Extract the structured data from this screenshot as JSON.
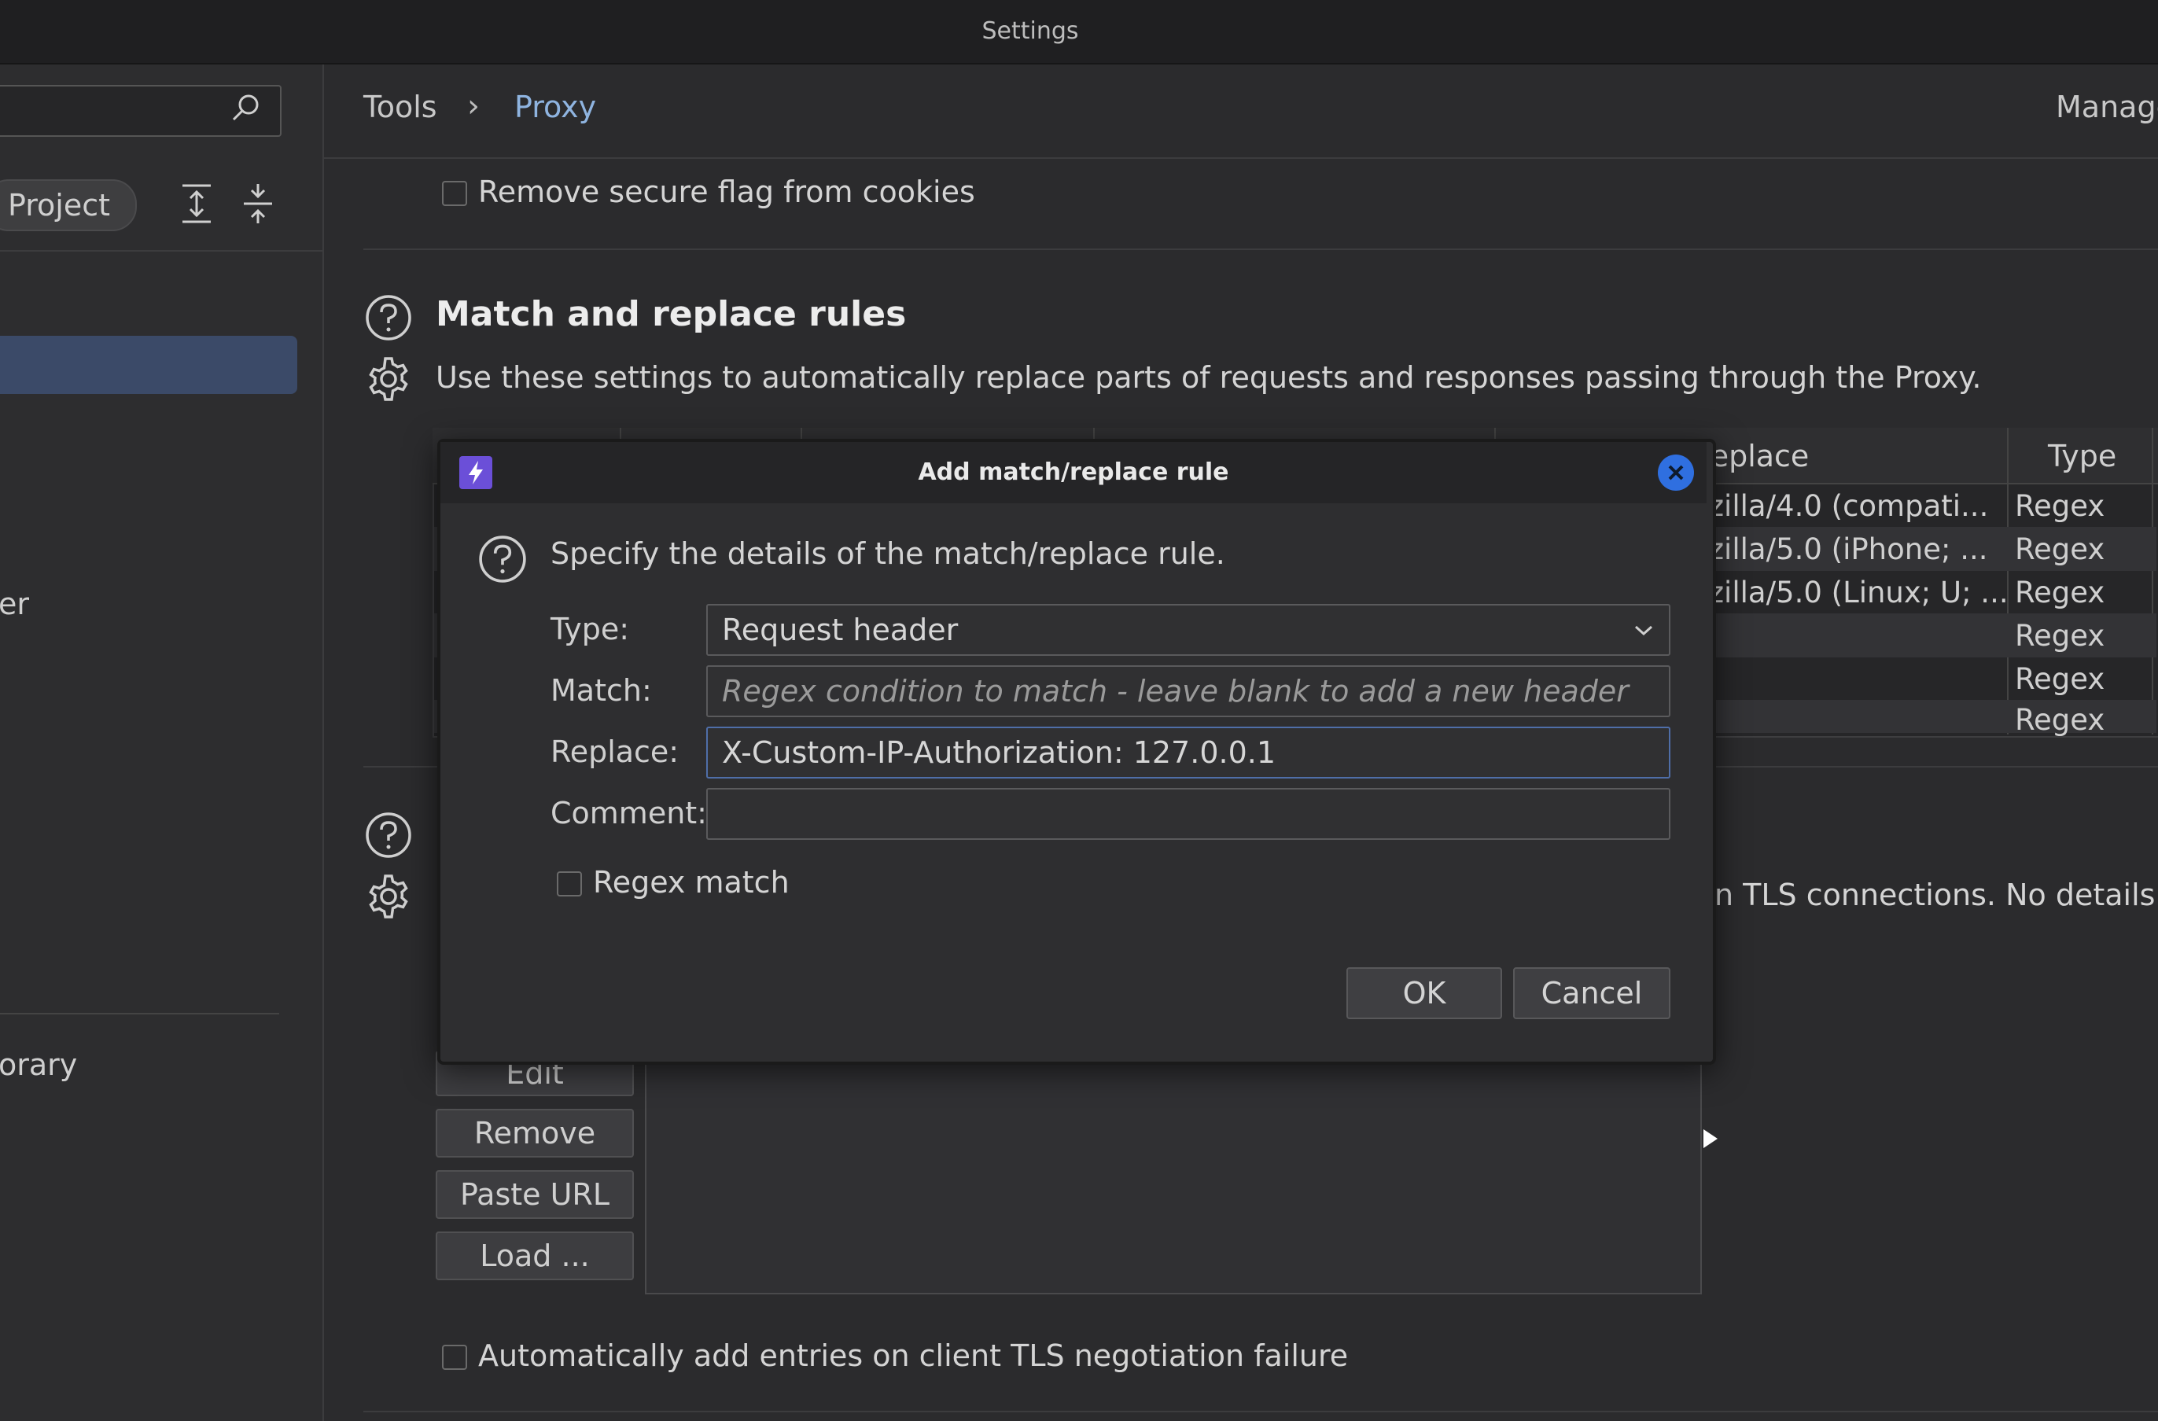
{
  "window": {
    "title": "Settings"
  },
  "sidebar": {
    "search_placeholder": "",
    "project_pill": "Project",
    "partial_items": [
      "er",
      "orary"
    ]
  },
  "header": {
    "crumb_tools": "Tools",
    "crumb_sep": "›",
    "crumb_proxy": "Proxy",
    "right_link": "Manage"
  },
  "proxy": {
    "remove_secure_flag": "Remove secure flag from cookies",
    "section_title": "Match and replace rules",
    "section_desc": "Use these settings to automatically replace parts of requests and responses passing through the Proxy.",
    "table": {
      "headers": {
        "replace": "Replace",
        "type": "Type"
      },
      "rows": [
        {
          "replace": "ozilla/4.0 (compati...",
          "type": "Regex"
        },
        {
          "replace": "ozilla/5.0 (iPhone; ...",
          "type": "Regex"
        },
        {
          "replace": "ozilla/5.0 (Linux; U; ...",
          "type": "Regex"
        },
        {
          "replace": "",
          "type": "Regex"
        },
        {
          "replace": "",
          "type": "Regex"
        },
        {
          "replace": "",
          "type": "Regex"
        }
      ]
    },
    "tls_text": "n TLS connections. No details abo",
    "buttons": {
      "edit": "Edit",
      "remove": "Remove",
      "paste_url": "Paste URL",
      "load": "Load ..."
    },
    "auto_add_tls": "Automatically add entries on client TLS negotiation failure"
  },
  "dialog": {
    "title": "Add match/replace rule",
    "intro": "Specify the details of the match/replace rule.",
    "type_label": "Type:",
    "type_value": "Request header",
    "match_label": "Match:",
    "match_placeholder": "Regex condition to match - leave blank to add a new header",
    "replace_label": "Replace:",
    "replace_value": "X-Custom-IP-Authorization: 127.0.0.1",
    "comment_label": "Comment:",
    "comment_value": "",
    "regex_match_label": "Regex match",
    "ok": "OK",
    "cancel": "Cancel"
  },
  "colors": {
    "accent_link": "#8fb4e0",
    "selection": "#3b4a68",
    "close_button": "#2f6fe0",
    "burp_icon": "#6b4fd8"
  },
  "icons": [
    "search-icon",
    "expand-all-icon",
    "collapse-all-icon",
    "help-icon",
    "gear-icon",
    "burp-logo-icon",
    "close-icon",
    "chevron-down-icon"
  ]
}
